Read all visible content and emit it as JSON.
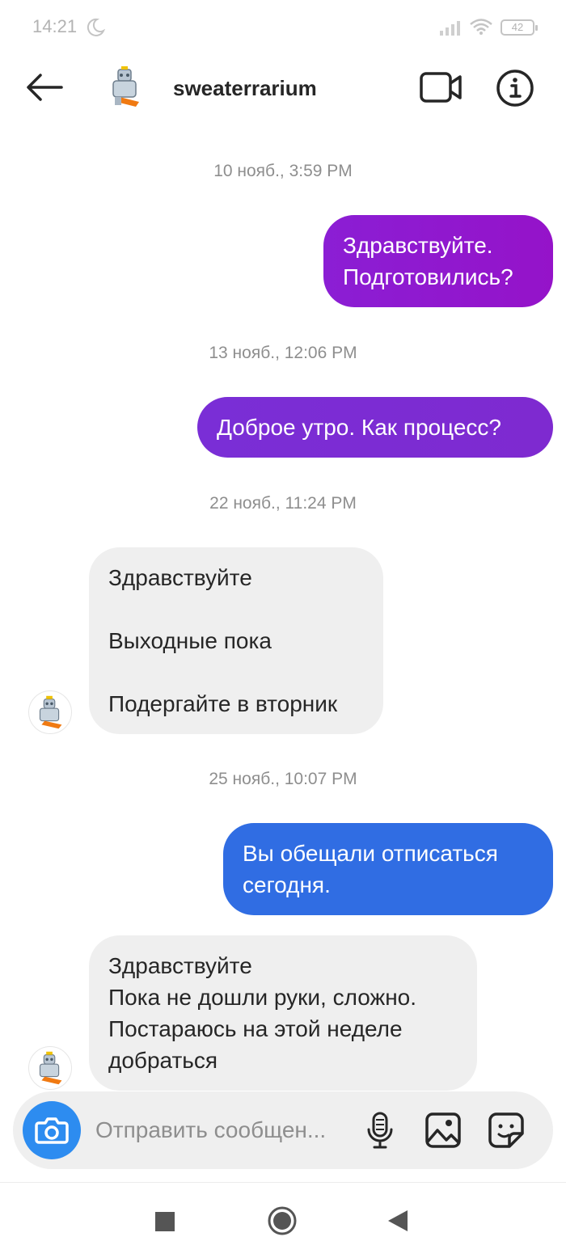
{
  "status_bar": {
    "time": "14:21",
    "battery": "42"
  },
  "header": {
    "username": "sweaterrarium"
  },
  "conversation": {
    "timestamps": [
      "10 нояб., 3:59 PM",
      "13 нояб., 12:06 PM",
      "22 нояб., 11:24 PM",
      "25 нояб., 10:07 PM"
    ],
    "messages": [
      {
        "direction": "outgoing",
        "text": "Здравствуйте.\nПодготовились?",
        "color": "#8b1ed4"
      },
      {
        "direction": "outgoing",
        "text": "Доброе утро. Как процесс?",
        "color": "#7a2ed6"
      },
      {
        "direction": "incoming",
        "text": "Здравствуйте\n\nВыходные пока\n\nПодергайте в вторник"
      },
      {
        "direction": "outgoing",
        "text": "Вы обещали отписаться\nсегодня.",
        "color": "#306de3"
      },
      {
        "direction": "incoming",
        "text": "Здравствуйте\nПока не дошли руки, сложно.\nПостараюсь на этой неделе\nдобраться"
      }
    ]
  },
  "composer": {
    "placeholder": "Отправить сообщен...",
    "camera_color": "#2d8cf0"
  },
  "icons": {
    "back": "arrow-left-icon",
    "video": "video-camera-icon",
    "info": "info-icon",
    "camera": "camera-icon",
    "mic": "microphone-icon",
    "gallery": "image-icon",
    "sticker": "sticker-icon"
  }
}
